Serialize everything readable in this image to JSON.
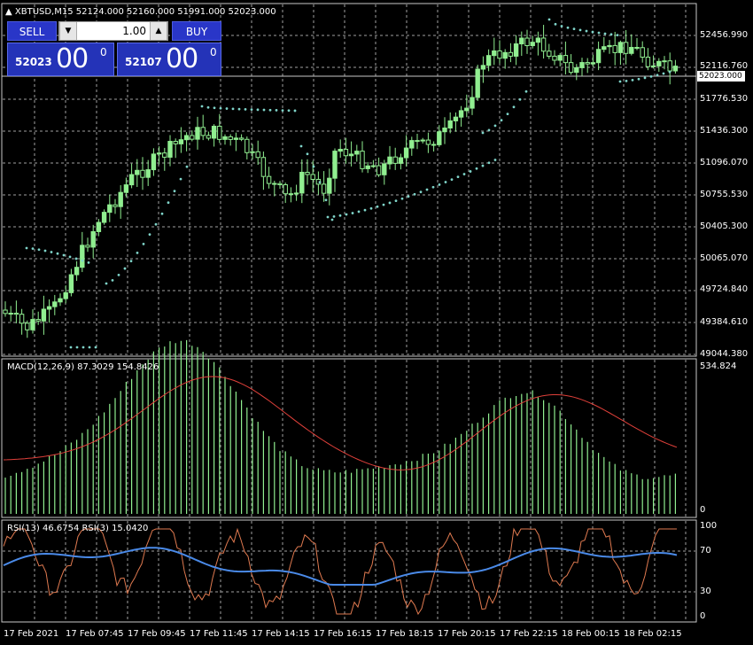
{
  "chart_header": {
    "title": "▲ XBTUSD,M15  52124.000 52160.000 51991.000 52023.000"
  },
  "trade_panel": {
    "sell_label": "SELL",
    "buy_label": "BUY",
    "volume": "1.00",
    "sell_price_small": "52023",
    "sell_price_big": "00",
    "sell_price_sup": "0",
    "buy_price_small": "52107",
    "buy_price_big": "00",
    "buy_price_sup": "0",
    "decrease_icon": "down-arrow",
    "increase_icon": "up-arrow"
  },
  "price_axis": {
    "labels": [
      "52456.990",
      "52116.760",
      "51776.530",
      "51436.300",
      "51096.070",
      "50755.530",
      "50405.300",
      "50065.070",
      "49724.840",
      "49384.610",
      "49044.380"
    ],
    "current": "52023.000"
  },
  "macd": {
    "title": "MACD(12,26,9) 87.3029 154.8426",
    "top": "534.824",
    "zero": "0"
  },
  "rsi": {
    "title": "RSI(13) 46.6754  RSI(3) 15.0420",
    "levels": [
      "100",
      "70",
      "30",
      "0"
    ]
  },
  "time_axis": [
    "17 Feb 2021",
    "17 Feb 07:45",
    "17 Feb 09:45",
    "17 Feb 11:45",
    "17 Feb 14:15",
    "17 Feb 16:15",
    "17 Feb 18:15",
    "17 Feb 20:15",
    "17 Feb 22:15",
    "18 Feb 00:15",
    "18 Feb 02:15"
  ],
  "colors": {
    "bull": "#90ee90",
    "bear": "#000000",
    "candle_border": "#90ee90",
    "psar": "#7fd4c9",
    "macd_hist": "#90ee90",
    "macd_signal": "#e0403a",
    "rsi13": "#4a8ae8",
    "rsi3": "#e07a50",
    "grid": "#a0a0a0"
  }
}
